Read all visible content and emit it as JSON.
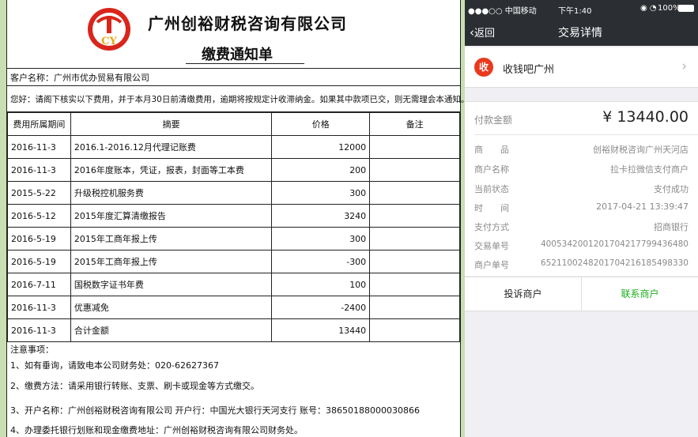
{
  "invoice": {
    "logo_letters": "CY",
    "company_name": "广州创裕财税咨询有限公司",
    "doc_title": "缴费通知单",
    "customer_line": "客户名称：广州市优办贸易有限公司",
    "greeting": "您好：请阁下核实以下费用，并于本月30日前清缴费用，逾期将按规定计收滞纳金。如果其中款项已交，则无需理会本通知。",
    "headers": [
      "费用所属期间",
      "摘要",
      "价格",
      "备注"
    ],
    "rows": [
      {
        "date": "2016-11-3",
        "desc": "2016.1-2016.12月代理记账费",
        "price": "12000",
        "note": ""
      },
      {
        "date": "2016-11-3",
        "desc": "2016年度账本，凭证，报表，封面等工本费",
        "price": "200",
        "note": ""
      },
      {
        "date": "2015-5-22",
        "desc": "升级税控机服务费",
        "price": "300",
        "note": ""
      },
      {
        "date": "2016-5-12",
        "desc": "2015年度汇算清缴报告",
        "price": "3240",
        "note": ""
      },
      {
        "date": "2016-5-19",
        "desc": "2015年工商年报上传",
        "price": "300",
        "note": ""
      },
      {
        "date": "2016-5-19",
        "desc": "2015年工商年报上传",
        "price": "-300",
        "note": ""
      },
      {
        "date": "2016-7-11",
        "desc": "国税数字证书年费",
        "price": "100",
        "note": ""
      },
      {
        "date": "2016-11-3",
        "desc": "优惠减免",
        "price": "-2400",
        "note": ""
      },
      {
        "date": "2016-11-3",
        "desc": "合计金额",
        "price": "13440",
        "note": ""
      }
    ],
    "notes_title": "注意事项：",
    "notes": [
      "1、如有垂询，请致电本公司财务处：020-62627367",
      "2、缴费方法：请采用银行转账、支票、刷卡或现金等方式缴交。",
      "3、开户名称：广州创裕财税咨询有限公司 开户行：中国光大银行天河支行 账号：38650188000030866",
      "4、办理委托银行划账和现金缴费地址：广州创裕财税咨询有限公司财务处。"
    ]
  },
  "phone": {
    "status": {
      "carrier": "●●●○○ 中国移动",
      "time": "下午1:40",
      "battery": "100%"
    },
    "nav": {
      "back": "返回",
      "title": "交易详情"
    },
    "merchant": {
      "icon_text": "收",
      "name": "收钱吧广州"
    },
    "amount_label": "付款金额",
    "amount_value": "¥ 13440.00",
    "details": [
      {
        "label": "商　　品",
        "value": "创裕财税咨询广州天河店"
      },
      {
        "label": "商户名称",
        "value": "拉卡拉微信支付商户"
      },
      {
        "label": "当前状态",
        "value": "支付成功"
      },
      {
        "label": "时　　间",
        "value": "2017-04-21 13:39:47"
      },
      {
        "label": "支付方式",
        "value": "招商银行"
      },
      {
        "label": "交易单号",
        "value": "4005342001201704217799436480"
      },
      {
        "label": "商户单号",
        "value": "6521100248201704216185498330"
      }
    ],
    "complain_label": "投诉商户",
    "contact_label": "联系商户",
    "colors": {
      "accent_green": "#1aad19",
      "bar_dark": "#2b2f33",
      "icon_red": "#e8391e"
    }
  }
}
